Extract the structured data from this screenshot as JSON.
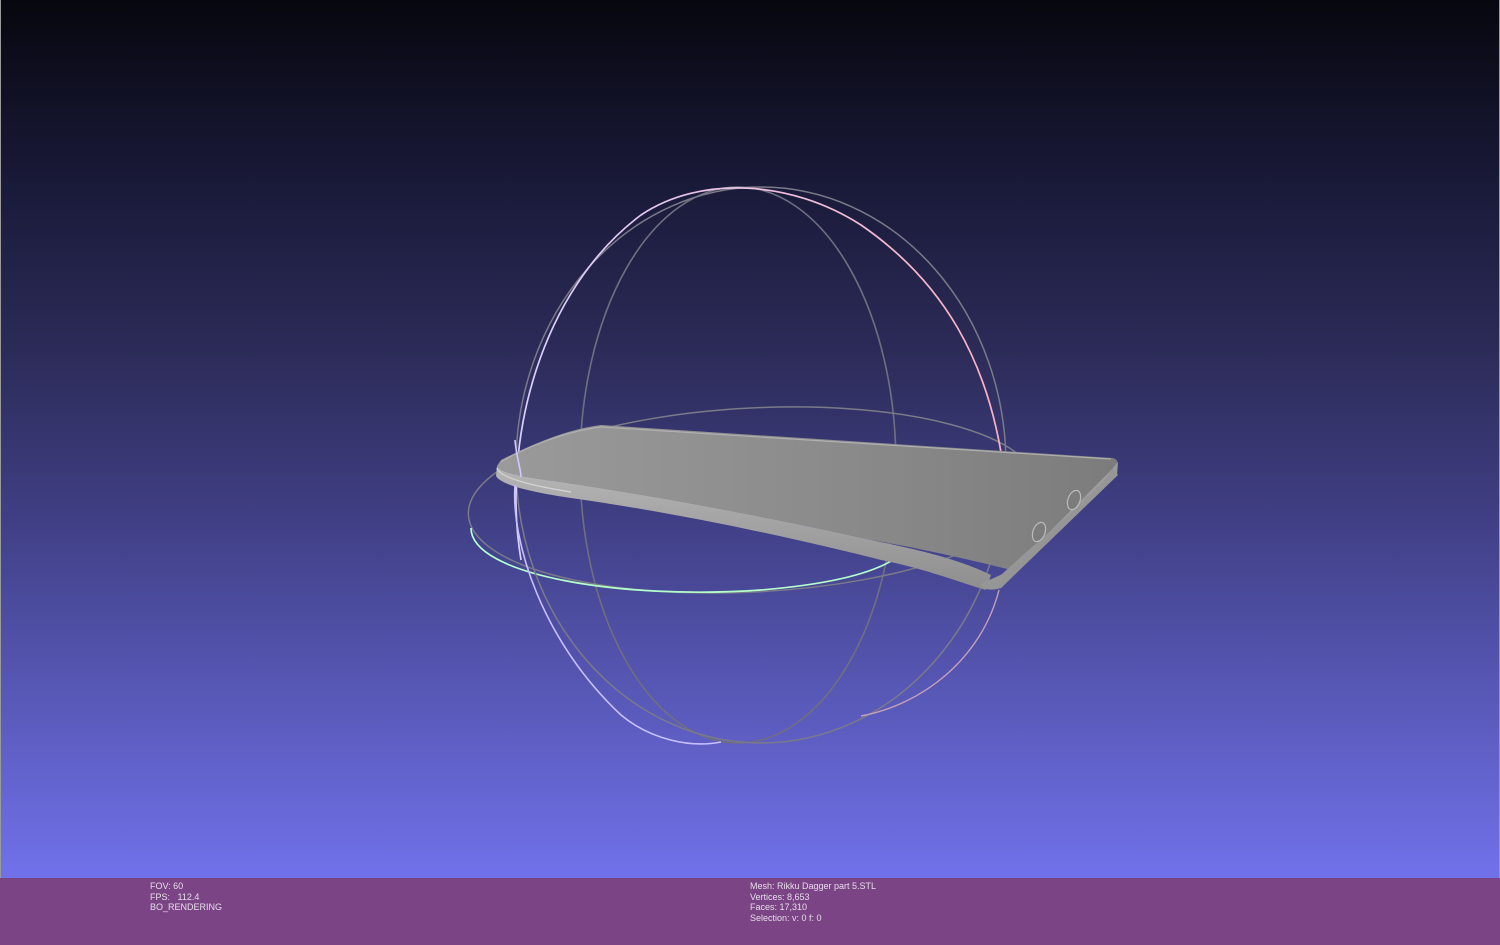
{
  "viewer": {
    "background_top": "#07070f",
    "background_bottom": "#7373ec",
    "info_bar_color": "#7b4585"
  },
  "scene": {
    "mesh_color": "#8a8a8a",
    "trackball_colors": {
      "x_ring": "#f0a0b8",
      "y_ring": "#a0ffc0",
      "z_ring": "#c0b0ff",
      "inactive": "#7a7a88"
    }
  },
  "info": {
    "fov": "FOV: 60",
    "fps": "FPS:   112.4",
    "mode": "BO_RENDERING",
    "mesh": "Mesh: Rikku Dagger part 5.STL",
    "vertices": "Vertices: 8,653",
    "faces": "Faces: 17,310",
    "selection": "Selection: v: 0 f: 0"
  }
}
